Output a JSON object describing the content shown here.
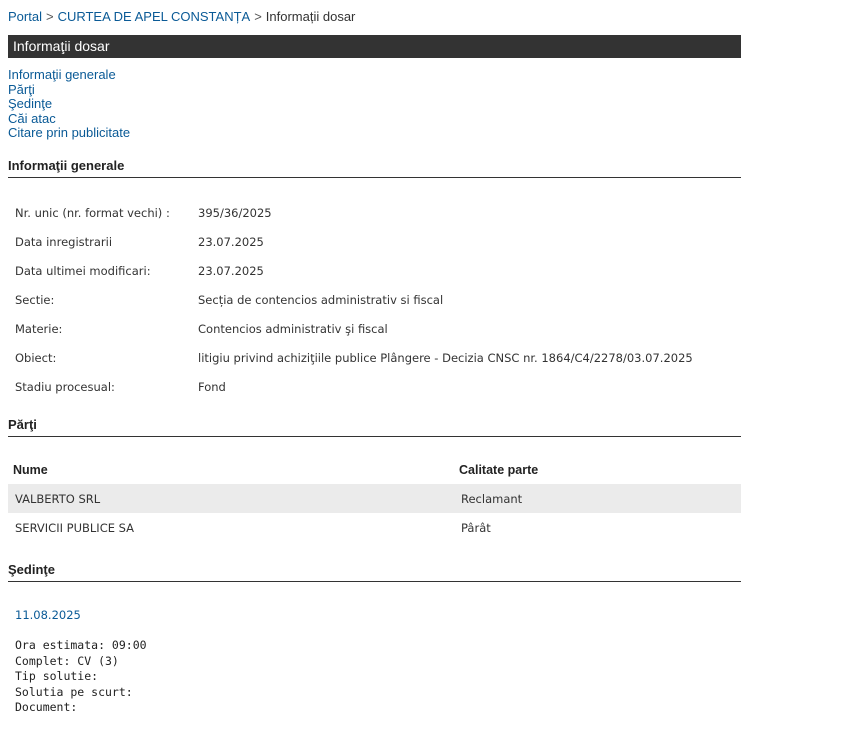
{
  "breadcrumb": {
    "items": [
      "Portal",
      "CURTEA DE APEL CONSTANȚA",
      "Informații dosar"
    ],
    "separator": ">"
  },
  "title_bar": "Informaţii dosar",
  "quick_links": [
    "Informaţii generale",
    "Părţi",
    "Şedinţe",
    "Căi atac",
    "Citare prin publicitate"
  ],
  "general": {
    "heading": "Informaţii generale",
    "rows": [
      {
        "label": "Nr. unic (nr. format vechi) :",
        "value": "395/36/2025"
      },
      {
        "label": "Data inregistrarii",
        "value": "23.07.2025"
      },
      {
        "label": "Data ultimei modificari:",
        "value": "23.07.2025"
      },
      {
        "label": "Sectie:",
        "value": "Secția de contencios administrativ si fiscal"
      },
      {
        "label": "Materie:",
        "value": "Contencios administrativ şi fiscal"
      },
      {
        "label": "Obiect:",
        "value": "litigiu privind achiziţiile publice Plângere - Decizia CNSC nr. 1864/C4/2278/03.07.2025"
      },
      {
        "label": "Stadiu procesual:",
        "value": "Fond"
      }
    ]
  },
  "parties": {
    "heading": "Părţi",
    "columns": [
      "Nume",
      "Calitate parte"
    ],
    "rows": [
      [
        "VALBERTO SRL",
        "Reclamant"
      ],
      [
        "SERVICII PUBLICE SA",
        "Pârât"
      ]
    ]
  },
  "hearings": {
    "heading": "Şedinţe",
    "date": "11.08.2025",
    "details": [
      "Ora estimata: 09:00",
      "Complet: CV (3)",
      "Tip solutie:",
      "Solutia pe scurt:",
      "Document:"
    ]
  },
  "colors": {
    "link": "#0a5a96",
    "title_bar_bg": "#333333",
    "row_shade": "#ebebeb"
  }
}
